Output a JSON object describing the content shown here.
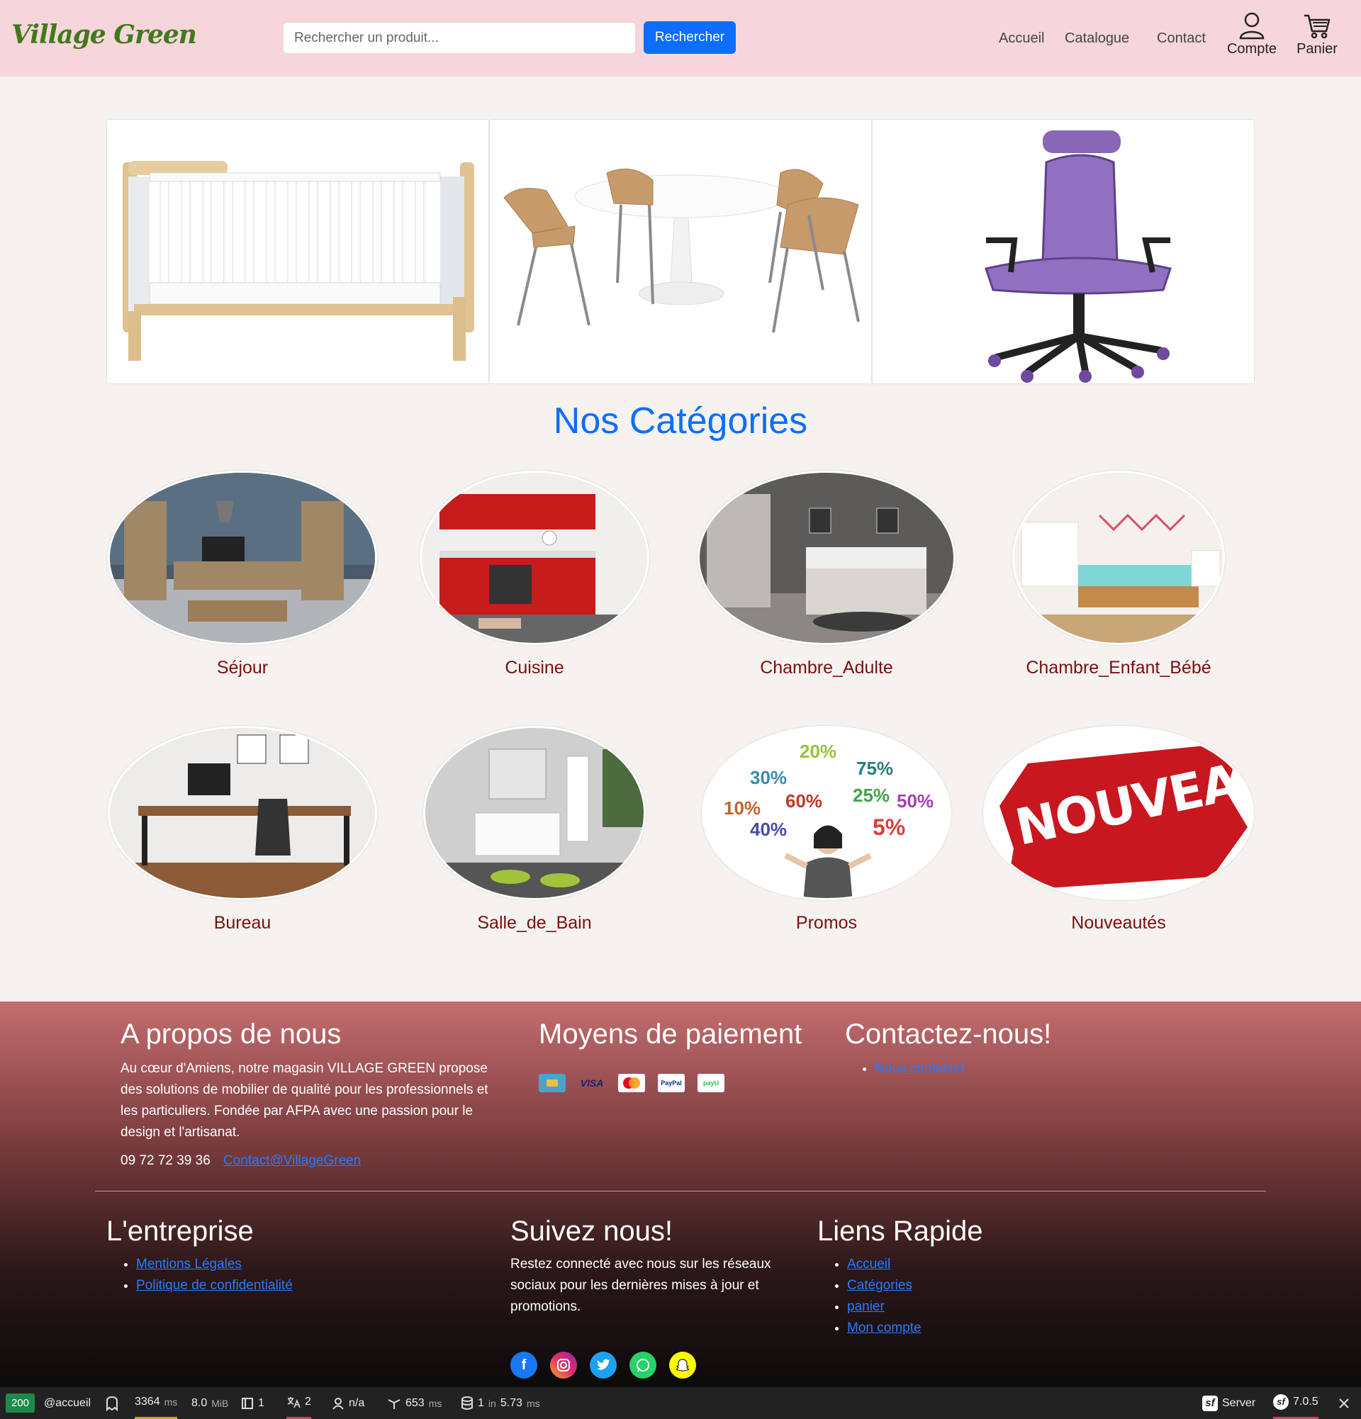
{
  "header": {
    "logo": "Village Green",
    "search_placeholder": "Rechercher un produit...",
    "search_button": "Rechercher",
    "nav": {
      "home": "Accueil",
      "catalog": "Catalogue",
      "contact": "Contact",
      "account": "Compte",
      "cart": "Panier"
    }
  },
  "categories": {
    "title": "Nos Catégories",
    "items": [
      {
        "label": "Séjour"
      },
      {
        "label": "Cuisine"
      },
      {
        "label": "Chambre_Adulte"
      },
      {
        "label": "Chambre_Enfant_Bébé"
      },
      {
        "label": "Bureau"
      },
      {
        "label": "Salle_de_Bain"
      },
      {
        "label": "Promos"
      },
      {
        "label": "Nouveautés"
      }
    ],
    "promo_percents": [
      "20%",
      "30%",
      "75%",
      "10%",
      "60%",
      "25%",
      "50%",
      "40%",
      "5%"
    ],
    "new_banner": "NOUVEAU"
  },
  "footer": {
    "about": {
      "title": "A propos de nous",
      "text": "Au cœur d'Amiens, notre magasin VILLAGE GREEN propose des solutions de mobilier de qualité pour les professionnels et les particuliers. Fondée par AFPA avec une passion pour le design et l'artisanat.",
      "phone": "09 72 72 39 36",
      "email": "Contact@VillageGreen"
    },
    "payment": {
      "title": "Moyens de paiement",
      "icons": [
        "card",
        "VISA",
        "mastercard",
        "PayPal",
        "payU"
      ]
    },
    "contact": {
      "title": "Contactez-nous!",
      "link": "Nous contacter"
    },
    "company": {
      "title": "L'entreprise",
      "links": [
        "Mentions Légales",
        "Politique de confidentialité"
      ]
    },
    "follow": {
      "title": "Suivez nous!",
      "text": "Restez connecté avec nous sur les réseaux sociaux pour les dernières mises à jour et promotions.",
      "icons": [
        "facebook-icon",
        "instagram-icon",
        "twitter-icon",
        "whatsapp-icon",
        "snapchat-icon"
      ]
    },
    "quick": {
      "title": "Liens Rapide",
      "links": [
        "Accueil",
        "Catégories",
        "panier",
        "Mon compte"
      ]
    }
  },
  "debug_toolbar": {
    "status": "200",
    "route": "@accueil",
    "time": "3364",
    "time_unit": "ms",
    "memory": "8.0",
    "memory_unit": "MiB",
    "forms": "1",
    "translations": "2",
    "user": "n/a",
    "ajax_time": "653",
    "ajax_unit": "ms",
    "db": "1",
    "db_in": "in",
    "db_time": "5.73",
    "db_unit": "ms",
    "server": "Server",
    "version": "7.0.5"
  },
  "colors": {
    "header_bg": "#f6d6da",
    "accent": "#0d6efd",
    "category_label": "#7a1010",
    "logo": "#3f7a1c"
  }
}
